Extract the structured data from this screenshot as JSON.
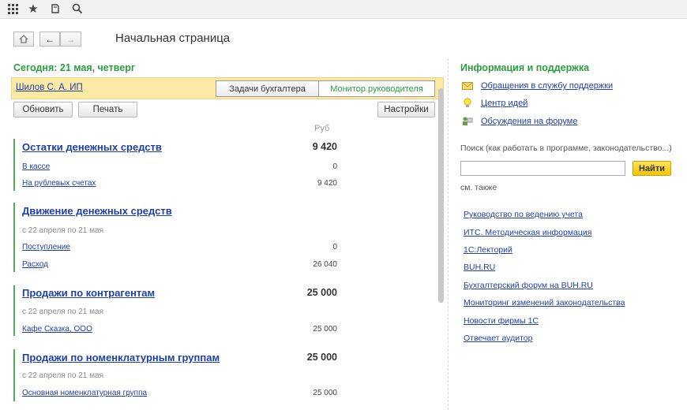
{
  "topbar": {
    "icons": [
      "apps-grid-icon",
      "star-icon",
      "history-icon",
      "search-icon"
    ]
  },
  "header": {
    "title": "Начальная страница"
  },
  "left": {
    "date": "Сегодня: 21 мая, четверг",
    "org": "Шилов С. А. ИП",
    "tabs": [
      "Задачи бухгалтера",
      "Монитор руководителя"
    ],
    "buttons": {
      "refresh": "Обновить",
      "print": "Печать",
      "settings": "Настройки"
    },
    "currency": "Руб",
    "sections": [
      {
        "title": "Остатки денежных средств",
        "total": "9 420",
        "period": "",
        "items": [
          {
            "label": "В кассе",
            "value": "0"
          },
          {
            "label": "На рублевых счетах",
            "value": "9 420"
          }
        ]
      },
      {
        "title": "Движение денежных средств",
        "total": "",
        "period": "с 22 апреля по 21 мая",
        "items": [
          {
            "label": "Поступление",
            "value": "0"
          },
          {
            "label": "Расход",
            "value": "26 040"
          }
        ]
      },
      {
        "title": "Продажи по контрагентам",
        "total": "25 000",
        "period": "с 22 апреля по 21 мая",
        "items": [
          {
            "label": "Кафе Сказка, ООО",
            "value": "25 000"
          }
        ]
      },
      {
        "title": "Продажи по номенклатурным группам",
        "total": "25 000",
        "period": "с 22 апреля по 21 мая",
        "items": [
          {
            "label": "Основная номенклатурная группа",
            "value": "25 000"
          }
        ]
      }
    ]
  },
  "right": {
    "title": "Информация и поддержка",
    "support": [
      {
        "icon": "envelope-icon",
        "label": "Обращения в службу поддержки"
      },
      {
        "icon": "lightbulb-icon",
        "label": "Центр идей"
      },
      {
        "icon": "forum-icon",
        "label": "Обсуждения на форуме"
      }
    ],
    "search": {
      "label": "Поиск (как работать в программе, законодательство...)",
      "value": "",
      "button": "Найти"
    },
    "see_also": "см. также",
    "links": [
      "Руководство по ведению учета",
      "ИТС. Методическая информация",
      "1С:Лекторий",
      "BUH.RU",
      "Бухгалтерский форум на BUH.RU",
      "Мониторинг изменений законодательства",
      "Новости фирмы 1С",
      "Отвечает аудитор"
    ]
  },
  "colors": {
    "accent_green": "#2a9d3f",
    "link_blue": "#1f3fa8",
    "band_yellow": "#fbeaa4",
    "find_yellow": "#f4c500"
  }
}
